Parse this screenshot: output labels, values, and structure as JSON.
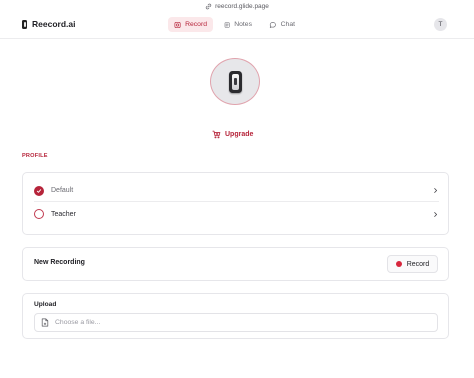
{
  "browser": {
    "url": "reecord.glide.page"
  },
  "header": {
    "app_name": "Reecord.ai",
    "tabs": [
      {
        "label": "Record",
        "active": true
      },
      {
        "label": "Notes",
        "active": false
      },
      {
        "label": "Chat",
        "active": false
      }
    ],
    "avatar_initial": "T"
  },
  "hero": {
    "upgrade_label": "Upgrade"
  },
  "profile": {
    "section_label": "PROFILE",
    "items": [
      {
        "label": "Default",
        "selected": true
      },
      {
        "label": "Teacher",
        "selected": false
      }
    ]
  },
  "recording": {
    "title": "New Recording",
    "button_label": "Record"
  },
  "upload": {
    "title": "Upload",
    "placeholder": "Choose a file..."
  },
  "colors": {
    "accent": "#b6243a",
    "accent_light": "#fbe8ea",
    "record_dot": "#d7263d"
  }
}
